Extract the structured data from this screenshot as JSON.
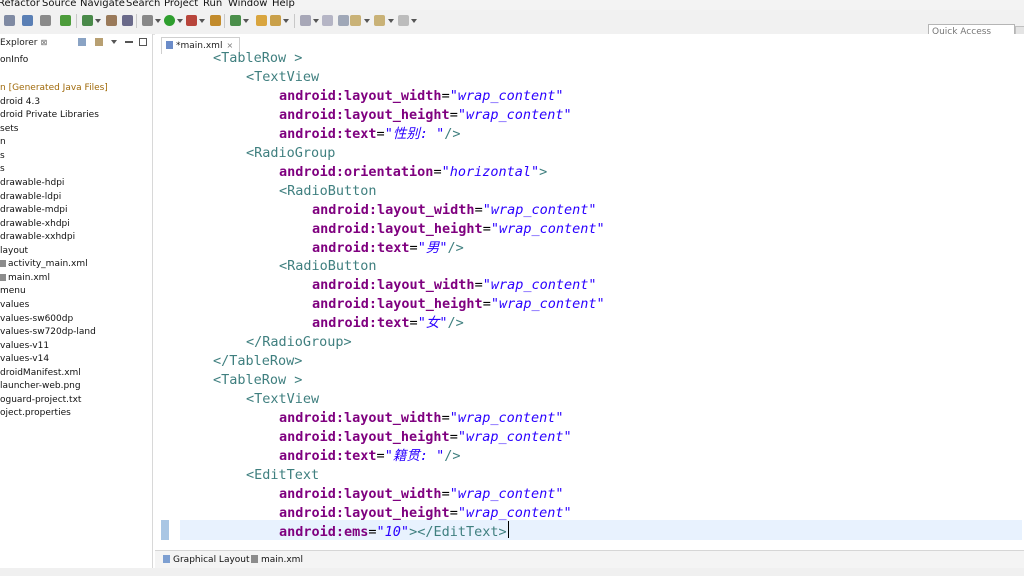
{
  "menu": [
    "Refactor",
    "Source",
    "Navigate",
    "Search",
    "Project",
    "Run",
    "Window",
    "Help"
  ],
  "quick_access_placeholder": "Quick Access",
  "explorer": {
    "tab_label": "Explorer",
    "tree": [
      "onInfo",
      "",
      "n [Generated Java Files]",
      "droid 4.3",
      "droid Private Libraries",
      "sets",
      "n",
      "s",
      "s",
      "drawable-hdpi",
      "drawable-ldpi",
      "drawable-mdpi",
      "drawable-xhdpi",
      "drawable-xxhdpi",
      "layout",
      "activity_main.xml",
      "main.xml",
      "menu",
      "values",
      "values-sw600dp",
      "values-sw720dp-land",
      "values-v11",
      "values-v14",
      "droidManifest.xml",
      "launcher-web.png",
      "oguard-project.txt",
      "oject.properties"
    ]
  },
  "editor": {
    "tab_label": "*main.xml",
    "bottom_tabs": [
      "Graphical Layout",
      "main.xml"
    ],
    "code_lines": [
      [
        [
          "tag",
          "<TableRow >"
        ]
      ],
      [
        [
          "tag",
          "<TextView"
        ]
      ],
      [
        [
          "attr",
          "android:layout_width"
        ],
        [
          "punct",
          "="
        ],
        [
          "val",
          "\"wrap_content\""
        ]
      ],
      [
        [
          "attr",
          "android:layout_height"
        ],
        [
          "punct",
          "="
        ],
        [
          "val",
          "\"wrap_content\""
        ]
      ],
      [
        [
          "attr",
          "android:text"
        ],
        [
          "punct",
          "="
        ],
        [
          "val",
          "\"性别: \""
        ],
        [
          "tag",
          "/>"
        ]
      ],
      [
        [
          "tag",
          "<RadioGroup"
        ]
      ],
      [
        [
          "attr",
          "android:orientation"
        ],
        [
          "punct",
          "="
        ],
        [
          "val",
          "\"horizontal\""
        ],
        [
          "tag",
          ">"
        ]
      ],
      [
        [
          "tag",
          "<RadioButton"
        ]
      ],
      [
        [
          "attr",
          "android:layout_width"
        ],
        [
          "punct",
          "="
        ],
        [
          "val",
          "\"wrap_content\""
        ]
      ],
      [
        [
          "attr",
          "android:layout_height"
        ],
        [
          "punct",
          "="
        ],
        [
          "val",
          "\"wrap_content\""
        ]
      ],
      [
        [
          "attr",
          "android:text"
        ],
        [
          "punct",
          "="
        ],
        [
          "val",
          "\"男\""
        ],
        [
          "tag",
          "/>"
        ]
      ],
      [
        [
          "tag",
          "<RadioButton"
        ]
      ],
      [
        [
          "attr",
          "android:layout_width"
        ],
        [
          "punct",
          "="
        ],
        [
          "val",
          "\"wrap_content\""
        ]
      ],
      [
        [
          "attr",
          "android:layout_height"
        ],
        [
          "punct",
          "="
        ],
        [
          "val",
          "\"wrap_content\""
        ]
      ],
      [
        [
          "attr",
          "android:text"
        ],
        [
          "punct",
          "="
        ],
        [
          "val",
          "\"女\""
        ],
        [
          "tag",
          "/>"
        ]
      ],
      [
        [
          "tag",
          "</RadioGroup>"
        ]
      ],
      [
        [
          "tag",
          "</TableRow>"
        ]
      ],
      [
        [
          "tag",
          "<TableRow >"
        ]
      ],
      [
        [
          "tag",
          "<TextView"
        ]
      ],
      [
        [
          "attr",
          "android:layout_width"
        ],
        [
          "punct",
          "="
        ],
        [
          "val",
          "\"wrap_content\""
        ]
      ],
      [
        [
          "attr",
          "android:layout_height"
        ],
        [
          "punct",
          "="
        ],
        [
          "val",
          "\"wrap_content\""
        ]
      ],
      [
        [
          "attr",
          "android:text"
        ],
        [
          "punct",
          "="
        ],
        [
          "val",
          "\"籍贯: \""
        ],
        [
          "tag",
          "/>"
        ]
      ],
      [
        [
          "tag",
          "<EditText"
        ]
      ],
      [
        [
          "attr",
          "android:layout_width"
        ],
        [
          "punct",
          "="
        ],
        [
          "val",
          "\"wrap_content\""
        ]
      ],
      [
        [
          "attr",
          "android:layout_height"
        ],
        [
          "punct",
          "="
        ],
        [
          "val",
          "\"wrap_content\""
        ]
      ],
      [
        [
          "attr",
          "android:ems"
        ],
        [
          "punct",
          "="
        ],
        [
          "val",
          "\"10\""
        ],
        [
          "tag",
          "></EditText>"
        ]
      ]
    ]
  },
  "colors": {
    "tag": "#3f7f7f",
    "attribute": "#7f007f",
    "value": "#2a00ff",
    "current_line": "#e8f2fe",
    "generated_files": "#a06a0b"
  },
  "icons": [
    "save-icon",
    "print-icon",
    "debug-icon",
    "run-icon",
    "search-icon",
    "new-icon",
    "navigate-icon",
    "folder-icon",
    "xml-file-icon",
    "collapse-icon",
    "link-icon",
    "minimize-icon",
    "maximize-icon"
  ]
}
